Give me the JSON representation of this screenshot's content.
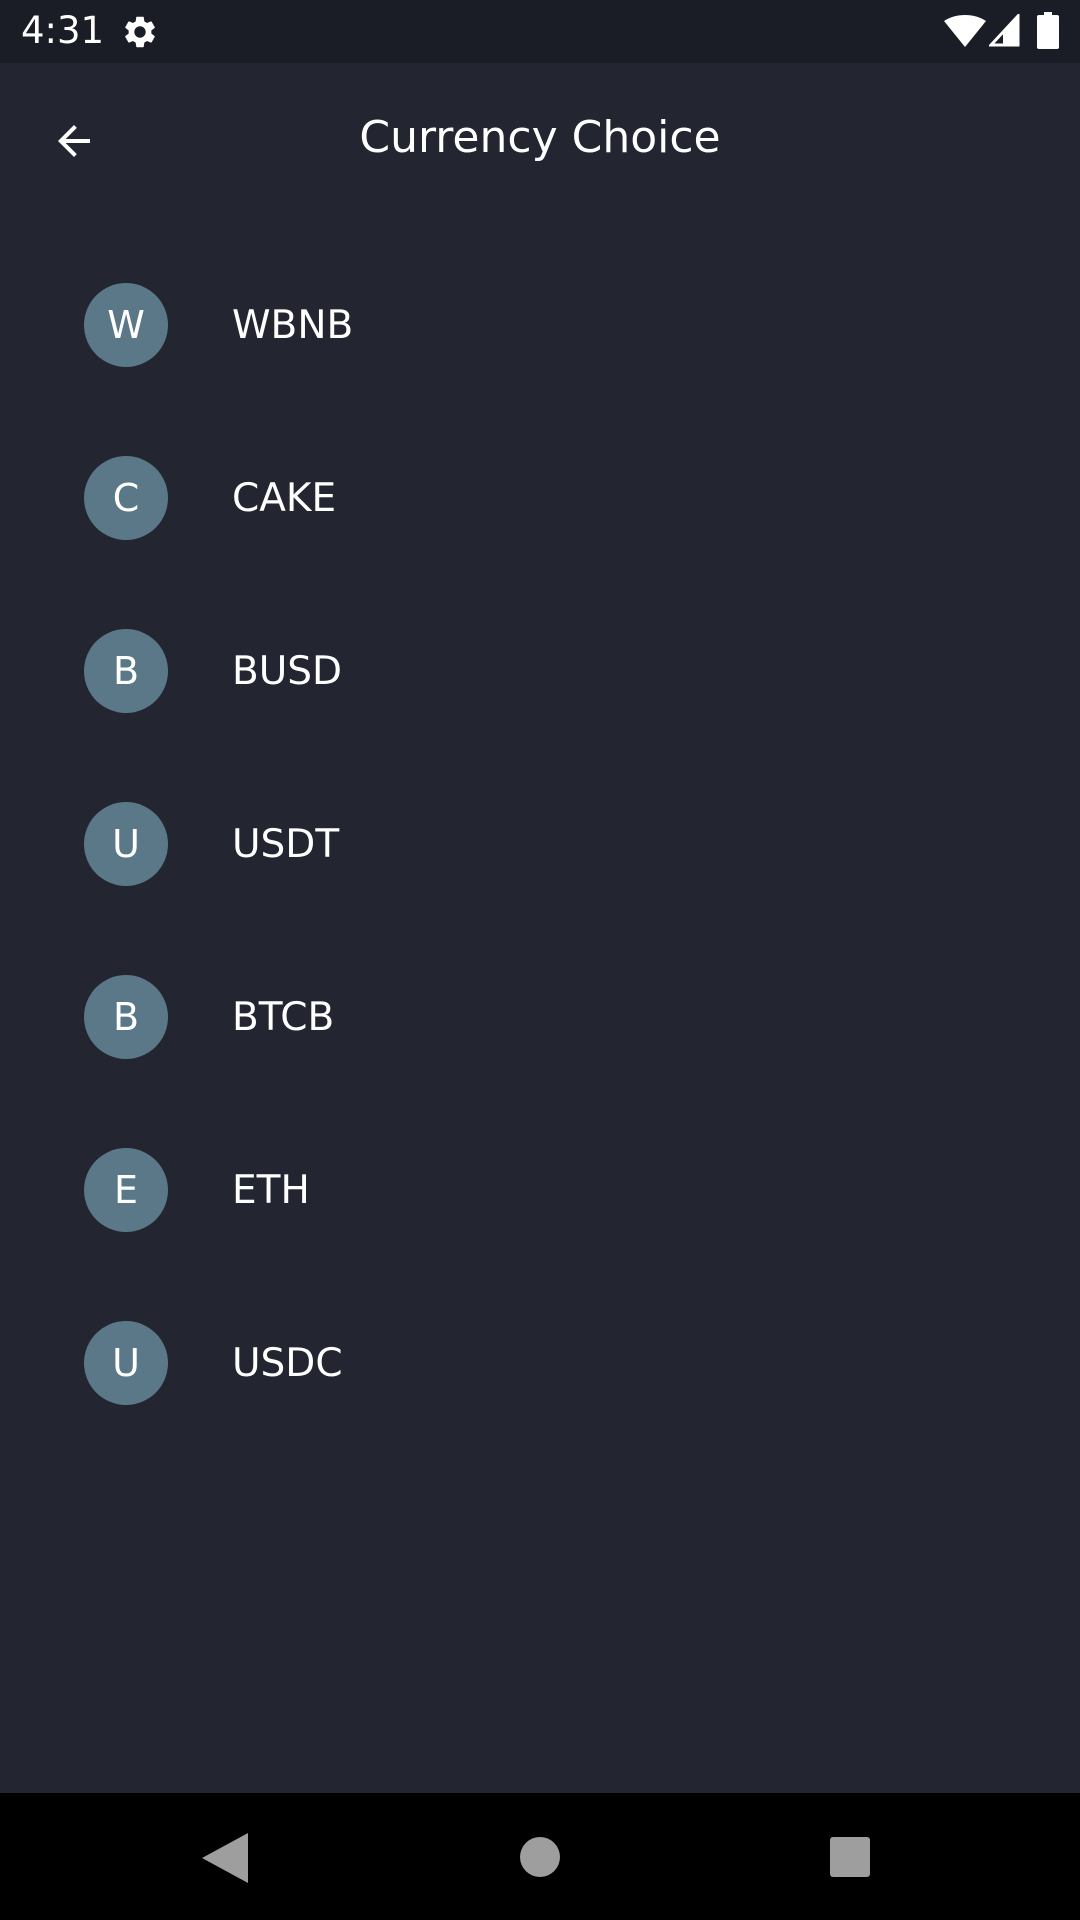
{
  "status_bar": {
    "time": "4:31",
    "icons": [
      "gear-icon",
      "wifi-icon",
      "signal-icon",
      "battery-icon"
    ]
  },
  "app_bar": {
    "title": "Currency Choice",
    "back_icon": "arrow-left-icon"
  },
  "currencies": [
    {
      "initial": "W",
      "symbol": "WBNB"
    },
    {
      "initial": "C",
      "symbol": "CAKE"
    },
    {
      "initial": "B",
      "symbol": "BUSD"
    },
    {
      "initial": "U",
      "symbol": "USDT"
    },
    {
      "initial": "B",
      "symbol": "BTCB"
    },
    {
      "initial": "E",
      "symbol": "ETH"
    },
    {
      "initial": "U",
      "symbol": "USDC"
    }
  ],
  "nav_bar": {
    "icons": [
      "nav-back-icon",
      "nav-home-icon",
      "nav-recents-icon"
    ]
  },
  "colors": {
    "background": "#232630",
    "status_bar": "#1b1d26",
    "avatar": "#5a7888",
    "nav_bar": "#000000"
  }
}
